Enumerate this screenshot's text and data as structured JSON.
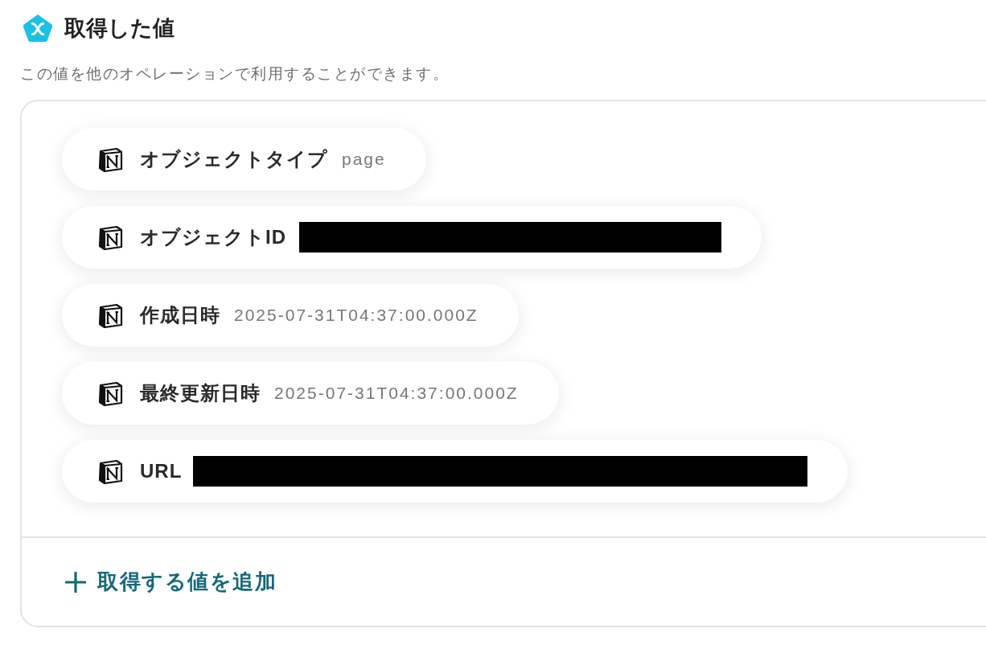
{
  "header": {
    "title": "取得した値",
    "description": "この値を他のオペレーションで利用することができます。"
  },
  "values": [
    {
      "label": "オブジェクトタイプ",
      "value": "page",
      "redacted": false
    },
    {
      "label": "オブジェクトID",
      "redacted": true
    },
    {
      "label": "作成日時",
      "value": "2025-07-31T04:37:00.000Z",
      "redacted": false
    },
    {
      "label": "最終更新日時",
      "value": "2025-07-31T04:37:00.000Z",
      "redacted": false
    },
    {
      "label": "URL",
      "redacted": true
    }
  ],
  "add_button": {
    "label": "取得する値を追加"
  }
}
